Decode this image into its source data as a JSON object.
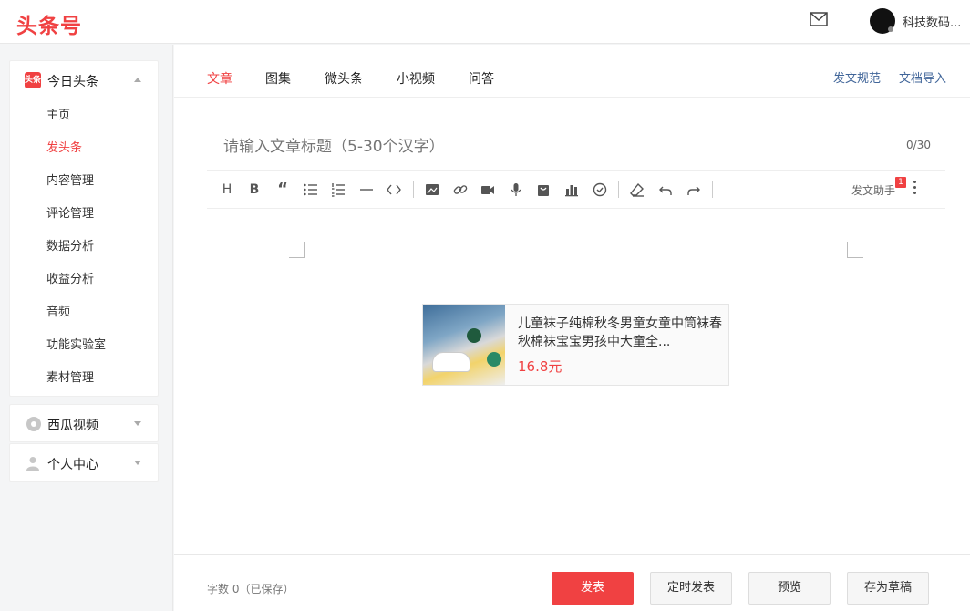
{
  "header": {
    "logo": "头条号",
    "username": "科技数码..."
  },
  "sidebar": {
    "toutiao": {
      "icon_text": "头条",
      "title": "今日头条",
      "items": [
        {
          "label": "主页"
        },
        {
          "label": "发头条"
        },
        {
          "label": "内容管理"
        },
        {
          "label": "评论管理"
        },
        {
          "label": "数据分析"
        },
        {
          "label": "收益分析"
        },
        {
          "label": "音频"
        },
        {
          "label": "功能实验室"
        },
        {
          "label": "素材管理"
        }
      ],
      "active_item": "发头条"
    },
    "xigua": {
      "title": "西瓜视频"
    },
    "personal": {
      "title": "个人中心"
    }
  },
  "tabs": [
    {
      "label": "文章"
    },
    {
      "label": "图集"
    },
    {
      "label": "微头条"
    },
    {
      "label": "小视频"
    },
    {
      "label": "问答"
    }
  ],
  "active_tab": "文章",
  "links": {
    "rules": "发文规范",
    "import": "文档导入"
  },
  "editor": {
    "title_placeholder": "请输入文章标题（5-30个汉字）",
    "title_counter": "0/30",
    "assistant_label": "发文助手",
    "assistant_badge": "1"
  },
  "product": {
    "name": "儿童袜子纯棉秋冬男童女童中筒袜春秋棉袜宝宝男孩中大童全...",
    "price": "16.8元"
  },
  "footer": {
    "word_count": "字数 0（已保存）",
    "publish": "发表",
    "schedule": "定时发表",
    "preview": "预览",
    "save_draft": "存为草稿"
  },
  "colors": {
    "accent": "#f04142",
    "link": "#406599"
  }
}
